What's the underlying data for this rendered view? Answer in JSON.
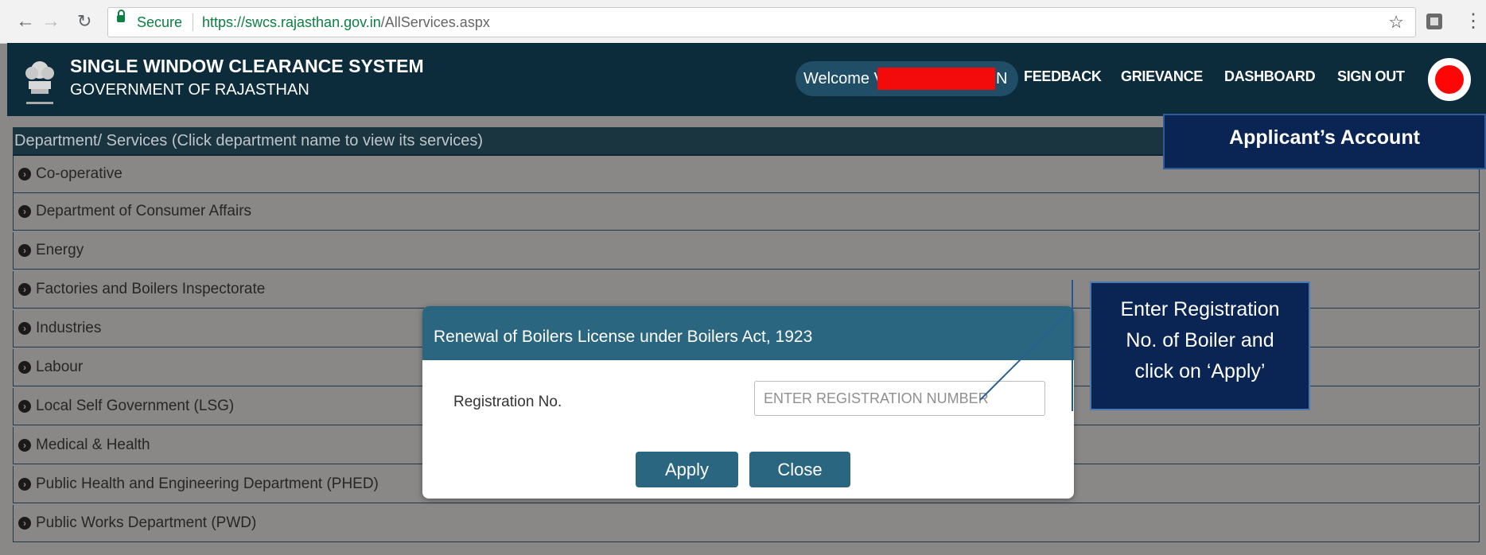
{
  "browser": {
    "secure_label": "Secure",
    "url_host": "https://swcs.rajasthan.gov.in",
    "url_path": "/AllServices.aspx"
  },
  "header": {
    "title": "SINGLE WINDOW CLEARANCE SYSTEM",
    "subtitle": "GOVERNMENT OF RAJASTHAN",
    "welcome_prefix": "Welcome V",
    "welcome_suffix": "N",
    "nav": [
      "FEEDBACK",
      "GRIEVANCE",
      "DASHBOARD",
      "SIGN OUT"
    ]
  },
  "panel": {
    "heading": "Department/ Services (Click department name to view its services)",
    "departments": [
      "Co-operative",
      "Department of Consumer Affairs",
      "Energy",
      "Factories and Boilers Inspectorate",
      "Industries",
      "Labour",
      "Local Self Government (LSG)",
      "Medical & Health",
      "Public Health and Engineering Department (PHED)",
      "Public Works Department (PWD)"
    ]
  },
  "account_tag": "Applicant’s Account",
  "modal": {
    "title": "Renewal of Boilers License under Boilers Act, 1923",
    "field_label": "Registration No.",
    "placeholder": "ENTER REGISTRATION NUMBER",
    "apply_label": "Apply",
    "close_label": "Close"
  },
  "callout": {
    "line1": "Enter Registration",
    "line2": "No. of Boiler and",
    "line3": "click on ‘Apply’"
  },
  "colors": {
    "header_bg": "#0c2b3b",
    "modal_accent": "#2b6680",
    "callout_bg": "#0a2453",
    "redaction": "#f30a0a"
  }
}
